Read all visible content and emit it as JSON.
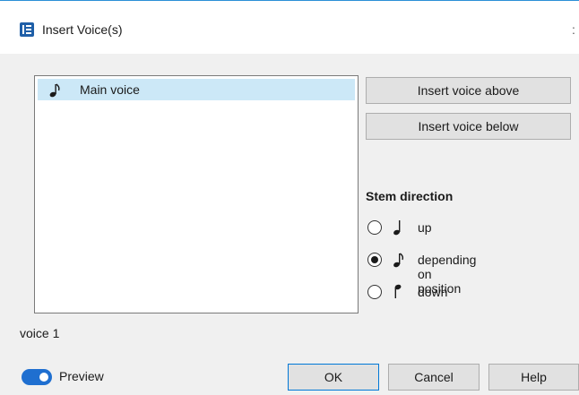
{
  "window": {
    "title": "Insert Voice(s)",
    "edge_glyph": ":"
  },
  "voice_list": {
    "items": [
      {
        "label": "Main voice",
        "icon": "eighth-note-stem-auto-icon",
        "selected": true
      }
    ]
  },
  "buttons": {
    "insert_above": "Insert voice above",
    "insert_below": "Insert voice below",
    "ok": "OK",
    "cancel": "Cancel",
    "help": "Help"
  },
  "stem_direction": {
    "heading": "Stem direction",
    "options": [
      {
        "label": "up",
        "icon": "quarter-note-stem-up-icon",
        "checked": false
      },
      {
        "label": "depending on position",
        "icon": "eighth-note-stem-auto-icon",
        "checked": true
      },
      {
        "label": "down",
        "icon": "note-stem-down-icon",
        "checked": false
      }
    ]
  },
  "voice_name": "voice 1",
  "preview": {
    "label": "Preview",
    "enabled": true
  },
  "colors": {
    "accent": "#1f6fd0",
    "selection": "#cce8f7",
    "app_icon": "#1f5fa8"
  }
}
